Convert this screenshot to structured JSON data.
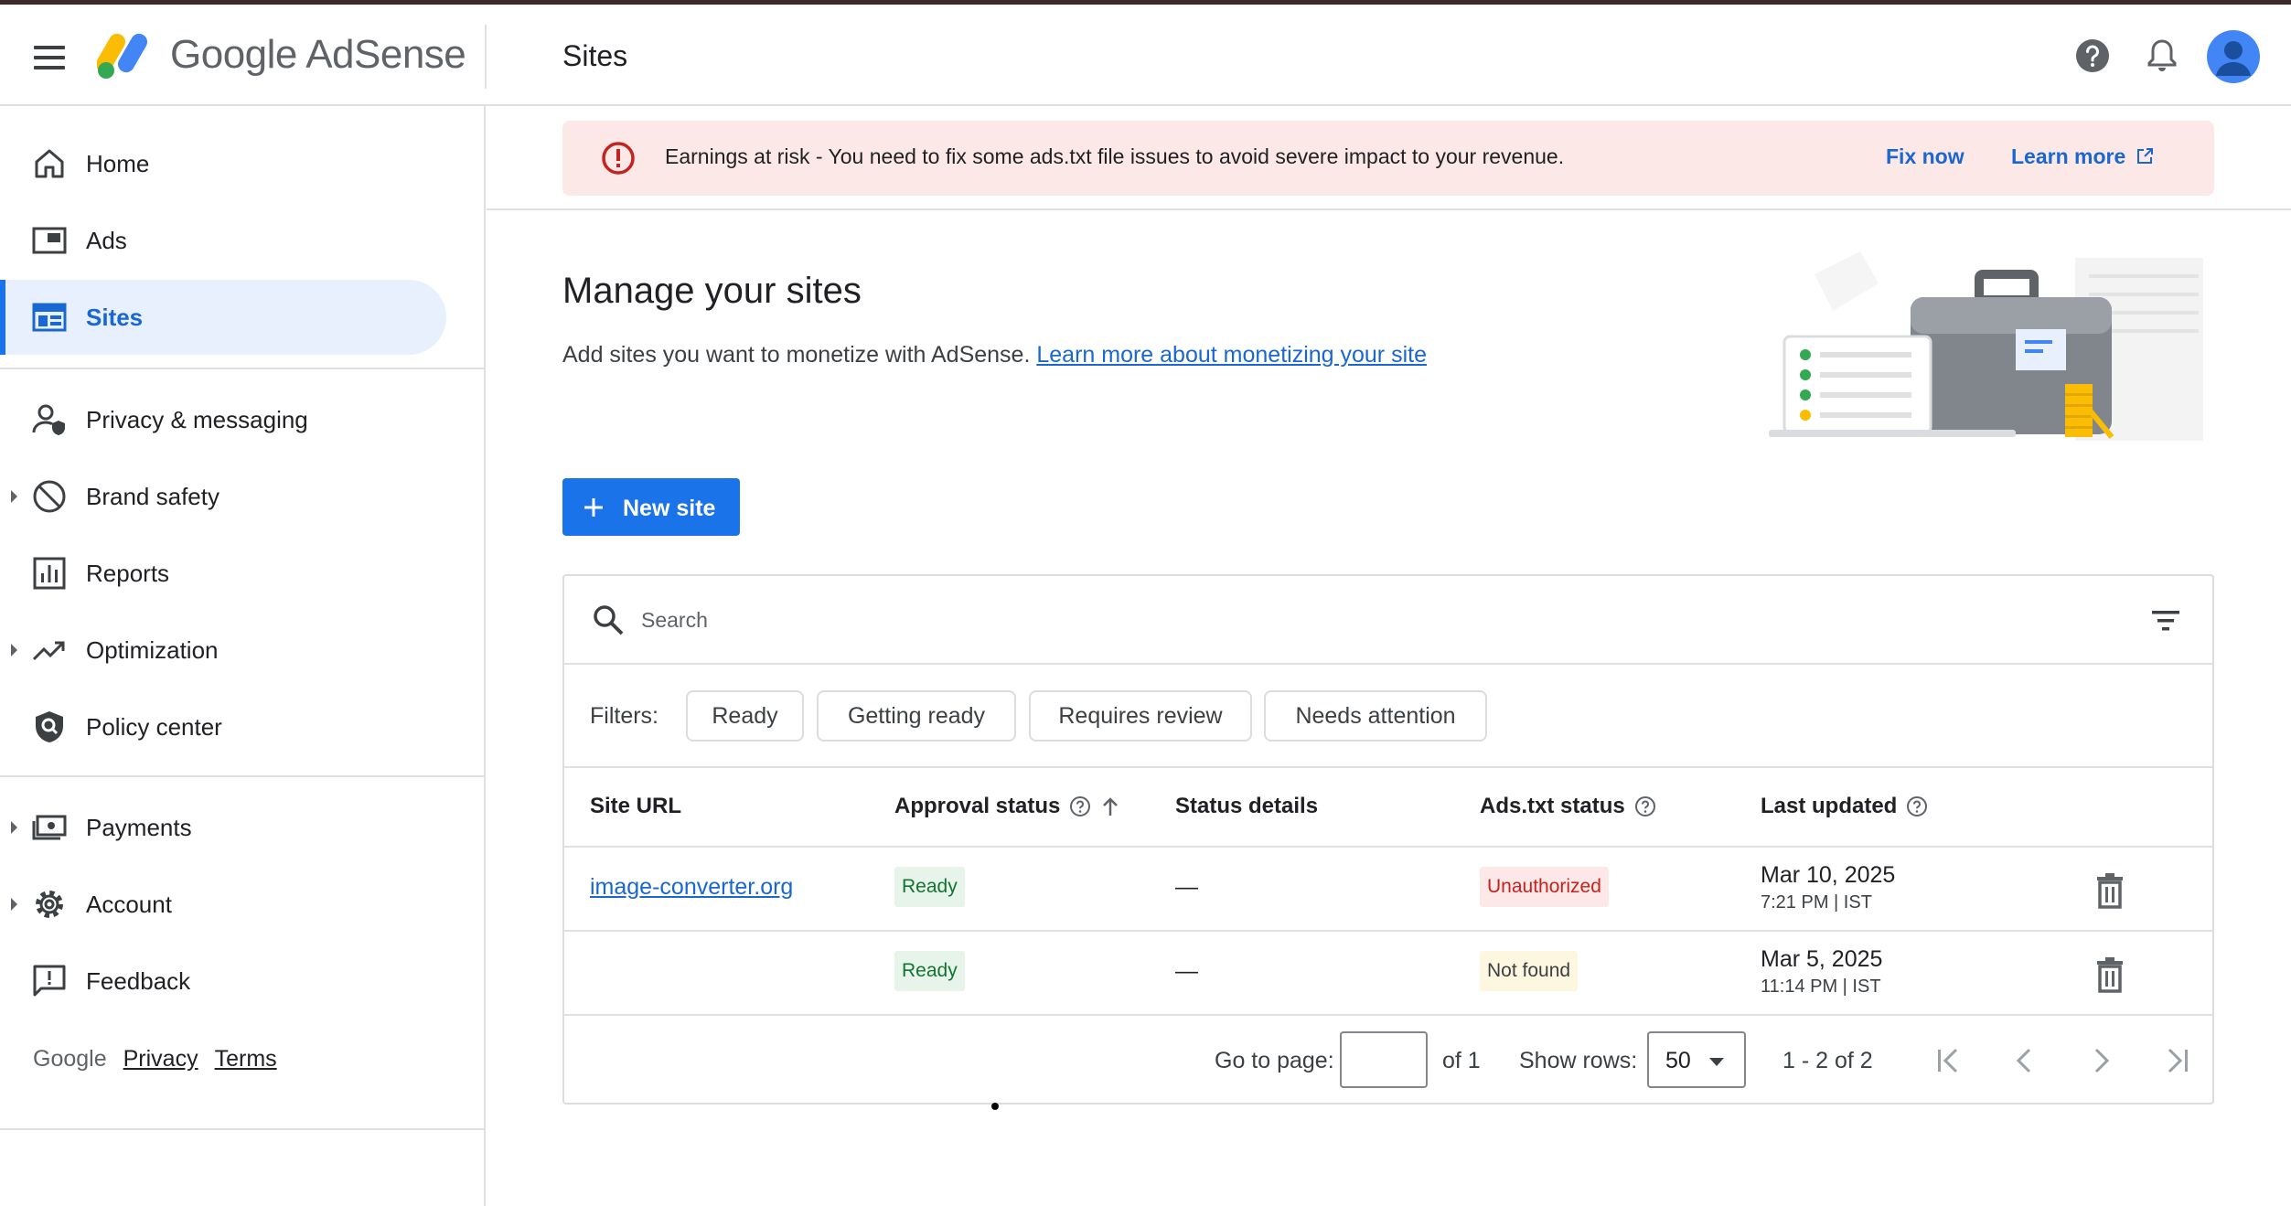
{
  "app": {
    "brand_google": "Google",
    "brand_product": "AdSense",
    "page_title": "Sites"
  },
  "header_icons": [
    "help-icon",
    "notifications-icon",
    "account-avatar"
  ],
  "sidebar": {
    "items": [
      {
        "label": "Home",
        "icon": "home-icon"
      },
      {
        "label": "Ads",
        "icon": "ads-icon"
      },
      {
        "label": "Sites",
        "icon": "sites-icon",
        "active": true
      },
      {
        "label": "Privacy & messaging",
        "icon": "privacy-icon"
      },
      {
        "label": "Brand safety",
        "icon": "block-icon",
        "expandable": true
      },
      {
        "label": "Reports",
        "icon": "reports-icon"
      },
      {
        "label": "Optimization",
        "icon": "trending-icon",
        "expandable": true
      },
      {
        "label": "Policy center",
        "icon": "policy-shield-icon"
      },
      {
        "label": "Payments",
        "icon": "payments-icon",
        "expandable": true
      },
      {
        "label": "Account",
        "icon": "gear-icon",
        "expandable": true
      },
      {
        "label": "Feedback",
        "icon": "feedback-icon"
      }
    ],
    "footer": {
      "google": "Google",
      "privacy": "Privacy",
      "terms": "Terms"
    }
  },
  "alert": {
    "message": "Earnings at risk - You need to fix some ads.txt file issues to avoid severe impact to your revenue.",
    "fix_now": "Fix now",
    "learn_more": "Learn more"
  },
  "main": {
    "title": "Manage your sites",
    "subtitle": "Add sites you want to monetize with AdSense.",
    "subtitle_link": "Learn more about monetizing your site",
    "new_site_label": "New site"
  },
  "table": {
    "search_placeholder": "Search",
    "filters_label": "Filters:",
    "filters": [
      "Ready",
      "Getting ready",
      "Requires review",
      "Needs attention"
    ],
    "columns": {
      "site_url": "Site URL",
      "approval_status": "Approval status",
      "status_details": "Status details",
      "ads_txt_status": "Ads.txt status",
      "last_updated": "Last updated"
    },
    "rows": [
      {
        "site_url": "image-converter.org",
        "approval": "Ready",
        "details": "—",
        "ads_txt": "Unauthorized",
        "date": "Mar 10, 2025",
        "time": "7:21 PM | IST"
      },
      {
        "site_url": "",
        "approval": "Ready",
        "details": "—",
        "ads_txt": "Not found",
        "date": "Mar 5, 2025",
        "time": "11:14 PM | IST"
      }
    ],
    "pagination": {
      "go_to_page": "Go to page:",
      "page_value": "",
      "of_pages": "of 1",
      "show_rows": "Show rows:",
      "rows_value": "50",
      "range": "1 - 2 of 2"
    }
  },
  "colors": {
    "accent": "#1a73e8",
    "active_nav_bg": "#e8f0fe",
    "alert_bg": "#fce8e6",
    "ready_bg": "#e6f4ea",
    "unauthorized_bg": "#fce8e6",
    "not_found_bg": "#fef7e0"
  }
}
